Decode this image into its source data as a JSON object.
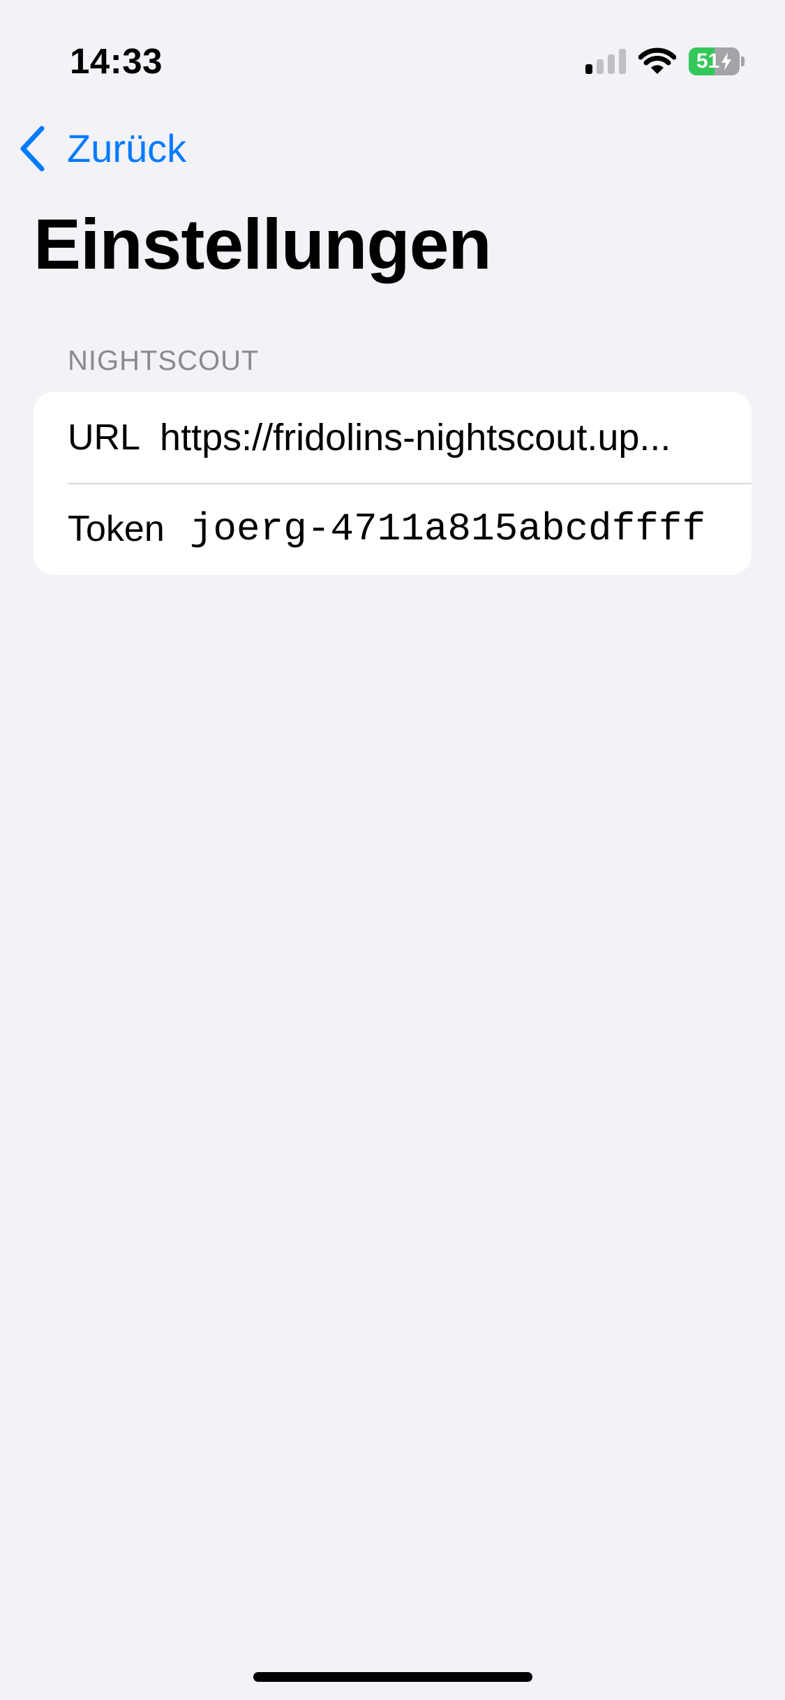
{
  "status_bar": {
    "time": "14:33",
    "battery_level": "51",
    "battery_fraction": 0.51,
    "charging": true,
    "signal_bars_active": 1,
    "signal_bars_total": 4
  },
  "nav": {
    "back_label": "Zurück"
  },
  "title": "Einstellungen",
  "sections": [
    {
      "header": "NIGHTSCOUT",
      "rows": [
        {
          "label": "URL",
          "value": "https://fridolins-nightscout.up..."
        },
        {
          "label": "Token",
          "value": "joerg-4711a815abcdffff"
        }
      ]
    }
  ],
  "colors": {
    "accent": "#007AFF",
    "background": "#F2F2F7",
    "section_header": "#8A8A8E",
    "battery_green": "#34C759"
  },
  "icons": {
    "back": "chevron-left-icon",
    "signal": "cellular-signal-icon",
    "wifi": "wifi-icon",
    "battery": "battery-charging-icon"
  }
}
